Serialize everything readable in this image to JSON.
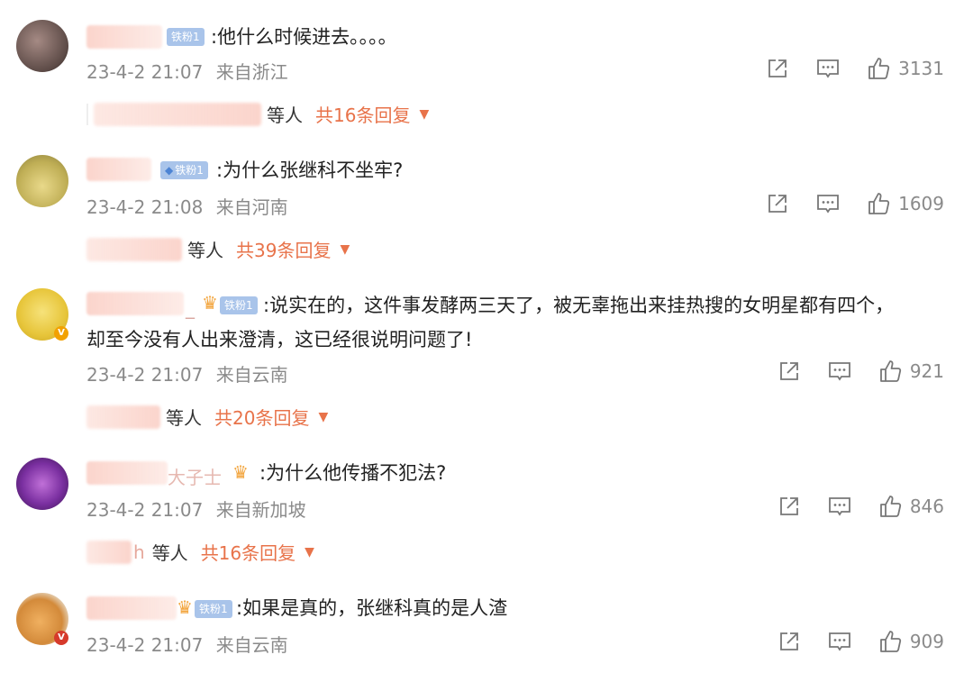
{
  "colors": {
    "accent": "#e8734a",
    "meta_text": "#8a8a8a",
    "fan_badge": "#a9c4ea",
    "verified_gold": "#f2a100",
    "verified_red": "#d63a2b"
  },
  "comments": [
    {
      "fan_badge": "铁粉1",
      "text": ":他什么时候进去。。。。",
      "time": "23-4-2 21:07",
      "location": "来自浙江",
      "likes": "3131",
      "reply_suffix": "等人",
      "reply_total": "共16条回复"
    },
    {
      "fan_badge": "铁粉1",
      "text": ":为什么张继科不坐牢?",
      "time": "23-4-2 21:08",
      "location": "来自河南",
      "likes": "1609",
      "reply_suffix": "等人",
      "reply_total": "共39条回复"
    },
    {
      "fan_badge": "铁粉1",
      "name_tail": "_",
      "text_line1": ":说实在的，这件事发酵两三天了，被无辜拖出来挂热搜的女明星都有四个，",
      "text_line2": "却至今没有人出来澄清，这已经很说明问题了!",
      "time": "23-4-2 21:07",
      "location": "来自云南",
      "likes": "921",
      "reply_suffix": "等人",
      "reply_total": "共20条回复"
    },
    {
      "name_tail": "大子士",
      "text": ":为什么他传播不犯法?",
      "time": "23-4-2 21:07",
      "location": "来自新加坡",
      "likes": "846",
      "reply_name_tail": "h",
      "reply_suffix": "等人",
      "reply_total": "共16条回复"
    },
    {
      "fan_badge": "铁粉1",
      "text": ":如果是真的，张继科真的是人渣",
      "time": "23-4-2 21:07",
      "location": "来自云南",
      "likes": "909"
    }
  ]
}
